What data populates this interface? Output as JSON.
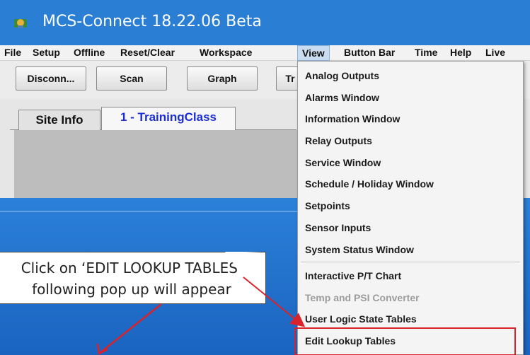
{
  "window": {
    "title": "MCS-Connect 18.22.06 Beta"
  },
  "menubar": {
    "items": [
      {
        "label": "File"
      },
      {
        "label": "Setup"
      },
      {
        "label": "Offline"
      },
      {
        "label": "Reset/Clear"
      },
      {
        "label": "Workspace"
      },
      {
        "label": "View"
      },
      {
        "label": "Button Bar"
      },
      {
        "label": "Time"
      },
      {
        "label": "Help"
      },
      {
        "label": "Live"
      }
    ]
  },
  "toolbar": {
    "buttons": [
      {
        "label": "Disconn..."
      },
      {
        "label": "Scan"
      },
      {
        "label": "Graph"
      },
      {
        "label": "Tr"
      }
    ]
  },
  "tabs": [
    {
      "label": "Site Info"
    },
    {
      "label": "1 - TrainingClass"
    }
  ],
  "view_menu": {
    "items": [
      {
        "label": "Analog Outputs"
      },
      {
        "label": "Alarms Window"
      },
      {
        "label": "Information Window"
      },
      {
        "label": "Relay Outputs"
      },
      {
        "label": "Service Window"
      },
      {
        "label": "Schedule / Holiday Window"
      },
      {
        "label": "Setpoints"
      },
      {
        "label": "Sensor Inputs"
      },
      {
        "label": "System Status Window"
      },
      {
        "label": "Interactive P/T Chart"
      },
      {
        "label": "Temp and PSI Converter"
      },
      {
        "label": "User Logic State Tables"
      },
      {
        "label": "Edit Lookup Tables"
      }
    ]
  },
  "callout": {
    "line1": "Click on ‘EDIT LOOKUP TABLES’",
    "line2": "following pop up will appear"
  },
  "colors": {
    "titlebar": "#2a7fd4",
    "highlight": "#d8232a",
    "tab_active_text": "#1c2fd6"
  }
}
